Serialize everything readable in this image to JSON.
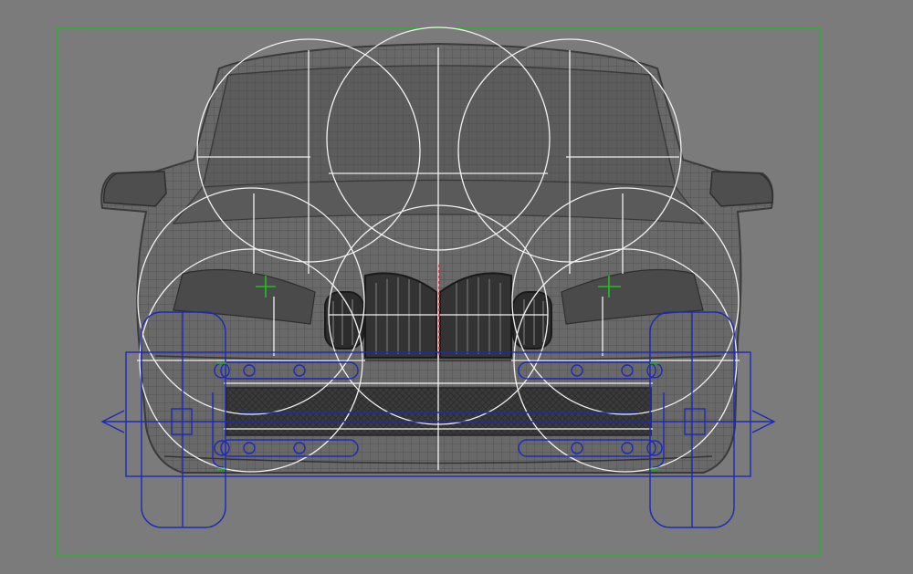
{
  "viewport": {
    "kind": "orthographic-front",
    "background": "#7b7b7b",
    "colors": {
      "safe_frame": "#1fb81f",
      "mesh_outline": "#3c3c3c",
      "mesh_fill": "#6c6c6c",
      "mesh_wire": "#505050",
      "control_white": "#f2f2f2",
      "control_blue": "#1c2ab8",
      "helper_green": "#21c021",
      "pivot_red": "#d42020"
    }
  }
}
